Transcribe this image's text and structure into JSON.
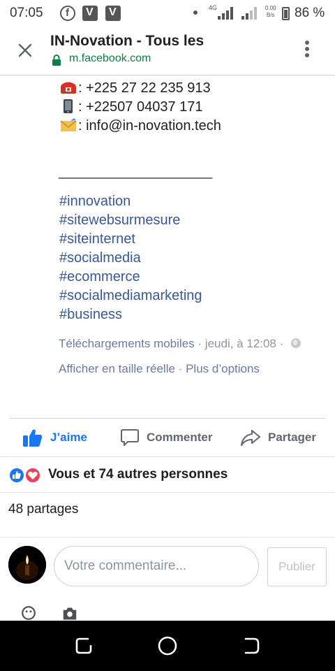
{
  "status_bar": {
    "time": "07:05",
    "network_type": "4G",
    "speed_value": "0.00",
    "speed_unit": "B/s",
    "battery": "86 %",
    "app_icons": [
      "facebook-icon",
      "v-app-icon",
      "v-app-icon"
    ]
  },
  "browser": {
    "title": "IN-Novation - Tous les",
    "url": "m.facebook.com",
    "icons": {
      "close": "close-icon",
      "lock": "lock-icon",
      "menu": "kebab-menu-icon"
    }
  },
  "post": {
    "contacts": [
      {
        "icon": "telephone-icon",
        "text": ": +225 27 22 235 913"
      },
      {
        "icon": "mobile-phone-icon",
        "text": ": +22507 04037 171"
      },
      {
        "icon": "envelope-icon",
        "text": ": info@in-novation.tech"
      }
    ],
    "separator": "______________________",
    "hashtags": [
      "#innovation",
      "#sitewebsurmesure",
      "#siteinternet",
      "#socialmedia",
      "#ecommerce",
      "#socialmediamarketing",
      "#business"
    ],
    "album": "Téléchargements mobiles",
    "timestamp": "jeudi, à 12:08",
    "view_full_size": "Afficher en taille réelle",
    "more_options": "Plus d’options",
    "dot": "·"
  },
  "actions": {
    "like": "J’aime",
    "comment": "Commenter",
    "share": "Partager"
  },
  "accent_color": "#1877f2",
  "reactions": {
    "summary": "Vous et 74 autres personnes",
    "types": [
      "like",
      "love"
    ]
  },
  "shares": "48 partages",
  "composer": {
    "placeholder": "Votre commentaire...",
    "publish": "Publier"
  }
}
